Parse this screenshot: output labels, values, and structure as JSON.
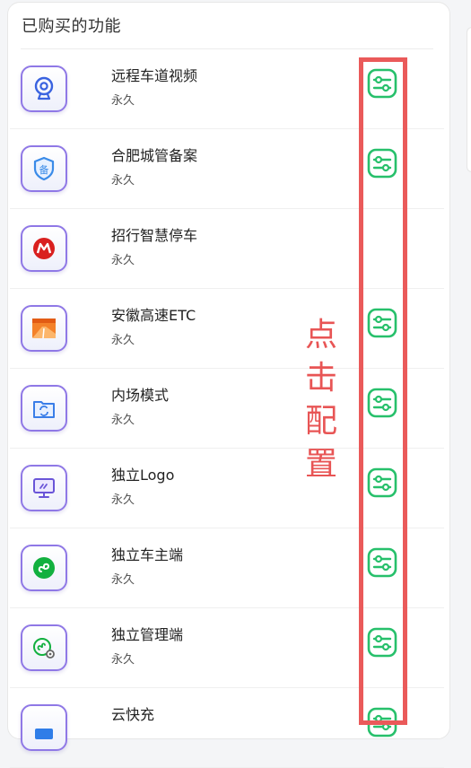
{
  "panel": {
    "title": "已购买的功能"
  },
  "annotation": {
    "chars": [
      "点",
      "击",
      "配",
      "置"
    ]
  },
  "colors": {
    "accent_purple": "#8f78e6",
    "config_green": "#27c06b",
    "highlight_red": "#ea5a5a"
  },
  "features": [
    {
      "name": "远程车道视频",
      "duration": "永久",
      "icon": "webcam-icon",
      "has_config": true
    },
    {
      "name": "合肥城管备案",
      "duration": "永久",
      "icon": "shield-bei-icon",
      "has_config": true
    },
    {
      "name": "招行智慧停车",
      "duration": "永久",
      "icon": "cmb-logo-icon",
      "has_config": false
    },
    {
      "name": "安徽高速ETC",
      "duration": "永久",
      "icon": "etc-card-icon",
      "has_config": true
    },
    {
      "name": "内场模式",
      "duration": "永久",
      "icon": "folder-sync-icon",
      "has_config": true
    },
    {
      "name": "独立Logo",
      "duration": "永久",
      "icon": "monitor-icon",
      "has_config": true
    },
    {
      "name": "独立车主端",
      "duration": "永久",
      "icon": "mini-program-icon",
      "has_config": true
    },
    {
      "name": "独立管理端",
      "duration": "永久",
      "icon": "mini-program-gear-icon",
      "has_config": true
    },
    {
      "name": "云快充",
      "duration": "",
      "icon": "cloud-charge-icon",
      "has_config": true
    }
  ]
}
